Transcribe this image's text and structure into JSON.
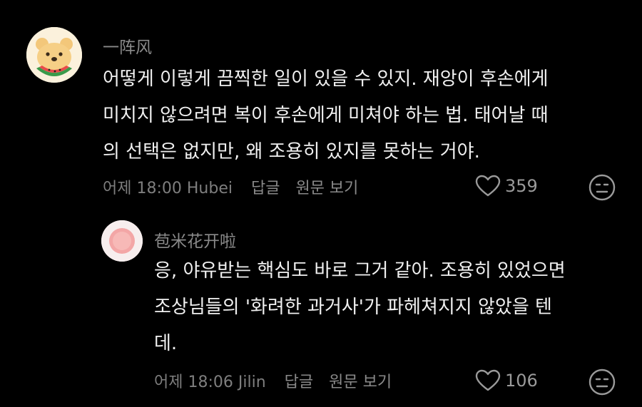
{
  "comment": {
    "username": "一阵风",
    "lines": [
      "어떻게 이렇게 끔찍한 일이 있을 수 있지. 재앙이 후손에게",
      "미치지 않으려면 복이 후손에게 미쳐야 하는 법. 태어날 때",
      "의 선택은 없지만, 왜 조용히 있지를 못하는 거야."
    ],
    "timestamp": "어제 18:00 Hubei",
    "reply_label": "답글",
    "view_original_label": "원문 보기",
    "like_count": "359"
  },
  "reply": {
    "username": "苞米花开啦",
    "lines": [
      "응, 야유받는 핵심도 바로 그거 같아. 조용히 있었으면",
      "조상님들의 '화려한 과거사'가 파헤쳐지지 않았을 텐",
      "데."
    ],
    "timestamp": "어제 18:06 Jilin",
    "reply_label": "답글",
    "view_original_label": "원문 보기",
    "like_count": "106"
  },
  "colors": {
    "background": "#000000",
    "text": "#f0f0f0",
    "muted": "#8a8a8a"
  }
}
